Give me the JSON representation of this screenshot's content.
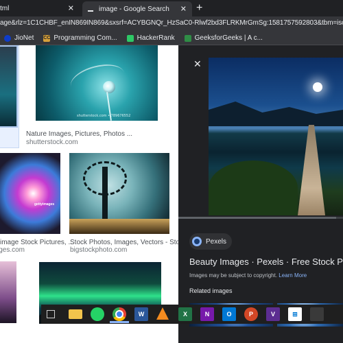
{
  "browser": {
    "tabs": [
      {
        "title": "tml",
        "close": "✕"
      },
      {
        "title": "image - Google Search",
        "close": "✕"
      }
    ],
    "new_tab": "+",
    "url": "age&rlz=1C1CHBF_enIN869IN869&sxsrf=ACYBGNQr_HzSaC0-Rlwf2bd3FLRKMrGmSg:1581757592803&tbm=isch&source=iu",
    "bookmarks": [
      {
        "label": "JioNet",
        "icon": "jionet-icon"
      },
      {
        "label": "Programming Com...",
        "icon": "programming-community-icon",
        "badge": "CC"
      },
      {
        "label": "HackerRank",
        "icon": "hackerrank-icon"
      },
      {
        "label": "GeeksforGeeks | A c...",
        "icon": "geeksforgeeks-icon"
      }
    ]
  },
  "results": [
    {
      "title": "Nature Images, Pictures, Photos ...",
      "source": "shutterstock.com",
      "credit": "shutterstock.com • 789676552"
    },
    {
      "title": "image Stock Pictures, ...",
      "source": "eaglesimages.com",
      "badge": "gettyimages"
    },
    {
      "title": "Stock Photos, Images, Vectors - Stock...",
      "source": "bigstockphoto.com"
    }
  ],
  "panel": {
    "close": "✕",
    "source_chip": "Pexels",
    "title": "Beauty Images · Pexels · Free Stock Pho",
    "copyright": "Images may be subject to copyright.",
    "learn_more": "Learn More",
    "related": "Related images"
  },
  "taskbar": {
    "apps": [
      "task-view",
      "file-explorer",
      "whatsapp",
      "chrome",
      "word",
      "vlc",
      "excel",
      "onenote",
      "outlook",
      "powerpoint",
      "visual-studio",
      "store",
      "app"
    ],
    "labels": {
      "word": "W",
      "excel": "X",
      "onenote": "N",
      "outlook": "O",
      "powerpoint": "P",
      "vs": "V",
      "store": "⊞"
    }
  },
  "colors": {
    "chrome_dark": "#202124",
    "toolbar": "#35363a",
    "link_blue": "#8ab4f8",
    "text_light": "#e8eaed"
  }
}
